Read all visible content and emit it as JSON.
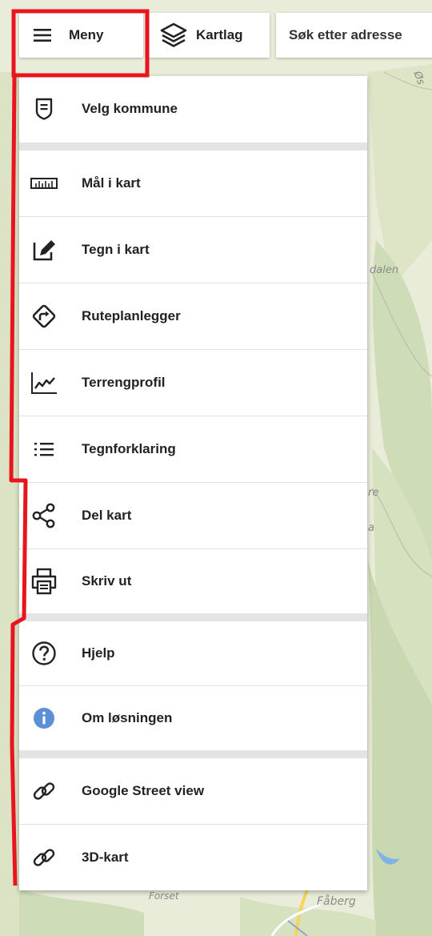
{
  "map": {
    "labels": [
      "Øs",
      "dalen",
      "re",
      "a",
      "Forset",
      "Fåberg"
    ]
  },
  "topbar": {
    "menu_label": "Meny",
    "layers_label": "Kartlag",
    "search_placeholder": "Søk etter adresse"
  },
  "menu": {
    "items": [
      {
        "label": "Velg kommune",
        "icon": "municipality-icon"
      },
      {
        "label": "Mål i kart",
        "icon": "ruler-icon"
      },
      {
        "label": "Tegn i kart",
        "icon": "draw-icon"
      },
      {
        "label": "Ruteplanlegger",
        "icon": "route-icon"
      },
      {
        "label": "Terrengprofil",
        "icon": "terrain-profile-icon"
      },
      {
        "label": "Tegnforklaring",
        "icon": "legend-list-icon"
      },
      {
        "label": "Del kart",
        "icon": "share-icon"
      },
      {
        "label": "Skriv ut",
        "icon": "print-icon"
      },
      {
        "label": "Hjelp",
        "icon": "help-icon"
      },
      {
        "label": "Om løsningen",
        "icon": "info-icon"
      },
      {
        "label": "Google Street view",
        "icon": "link-icon"
      },
      {
        "label": "3D-kart",
        "icon": "link-icon"
      }
    ]
  },
  "colors": {
    "annotation": "#e8141e",
    "info_icon": "#5b8fd6",
    "map_green": "#cfdcb8",
    "map_bg": "#e9ecd8"
  }
}
